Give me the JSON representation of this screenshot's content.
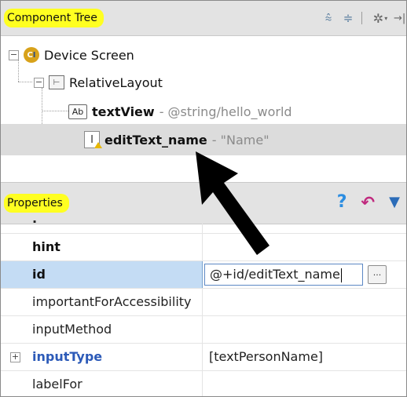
{
  "component_tree": {
    "title": "Component Tree",
    "toolbar": {
      "expand_icon": "expand-all-icon",
      "collapse_icon": "collapse-all-icon",
      "gear_icon": "gear-icon",
      "pin_icon": "hide-icon"
    },
    "nodes": [
      {
        "label": "Device Screen",
        "icon": "device-screen-icon"
      },
      {
        "label": "RelativeLayout",
        "icon": "relative-layout-icon"
      },
      {
        "label": "textView",
        "detail": "- @string/hello_world",
        "icon": "textview-icon",
        "icon_text": "Ab"
      },
      {
        "label": "editText_name",
        "detail": "- \"Name\"",
        "icon": "edittext-icon",
        "icon_text": "I"
      }
    ]
  },
  "properties": {
    "title": "Properties",
    "toolbar": {
      "help_icon": "help-icon",
      "undo_icon": "restore-default-icon",
      "filter_icon": "filter-icon"
    },
    "rows": [
      {
        "name": "hint",
        "value": ""
      },
      {
        "name": "id",
        "value": "@+id/editText_name",
        "selected": true,
        "browse_label": "..."
      },
      {
        "name": "importantForAccessibility",
        "value": ""
      },
      {
        "name": "inputMethod",
        "value": ""
      },
      {
        "name": "inputType",
        "value": "[textPersonName]",
        "expandable": true
      },
      {
        "name": "labelFor",
        "value": ""
      }
    ]
  },
  "colors": {
    "highlight": "#ffff21",
    "selection": "#c4dcf4",
    "accent_blue": "#2c5ab8"
  }
}
